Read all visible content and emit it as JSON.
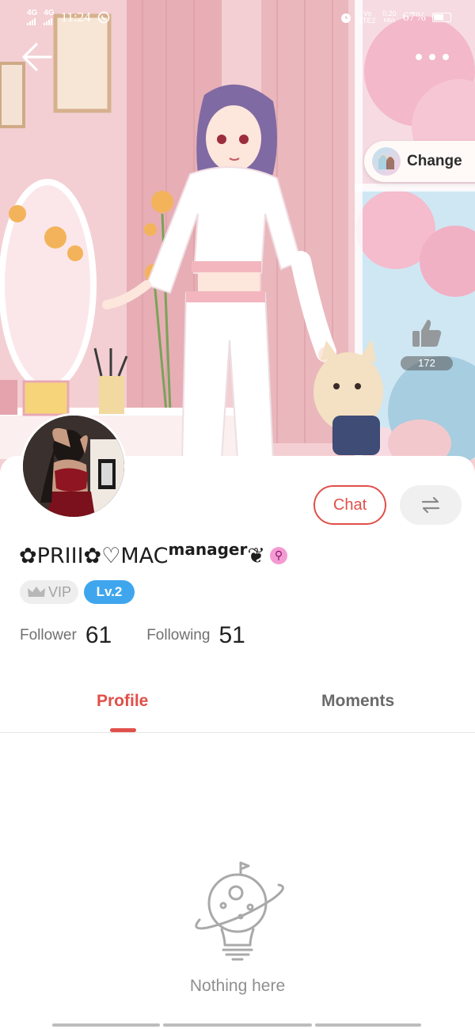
{
  "status_bar": {
    "network_1": "4G",
    "network_2": "4G",
    "time": "11:24",
    "volte": "Vo LTE2",
    "speed_value": "0.20",
    "speed_unit": "KB/s",
    "battery": "67%"
  },
  "hero": {
    "change_label": "Change",
    "like_count": "172"
  },
  "profile": {
    "name_prefix": "✿PRIII✿♡MAC",
    "name_sup": "manager",
    "name_suffix": "❦",
    "gender_symbol": "⚲",
    "vip_label": "VIP",
    "level_label": "Lv.2",
    "chat_label": "Chat",
    "follower_label": "Follower",
    "follower_count": "61",
    "following_label": "Following",
    "following_count": "51"
  },
  "tabs": [
    {
      "label": "Profile",
      "active": true
    },
    {
      "label": "Moments",
      "active": false
    }
  ],
  "empty_state": {
    "message": "Nothing here"
  },
  "colors": {
    "accent": "#e0504a",
    "level_badge": "#3fa6ee",
    "gender_badge": "#f49ad2"
  },
  "icons": {
    "back": "arrow-left-icon",
    "more": "more-dots-icon",
    "like": "thumbs-up-icon",
    "switch": "swap-arrows-icon",
    "vip": "crown-icon",
    "empty": "lightbulb-planet-icon"
  }
}
